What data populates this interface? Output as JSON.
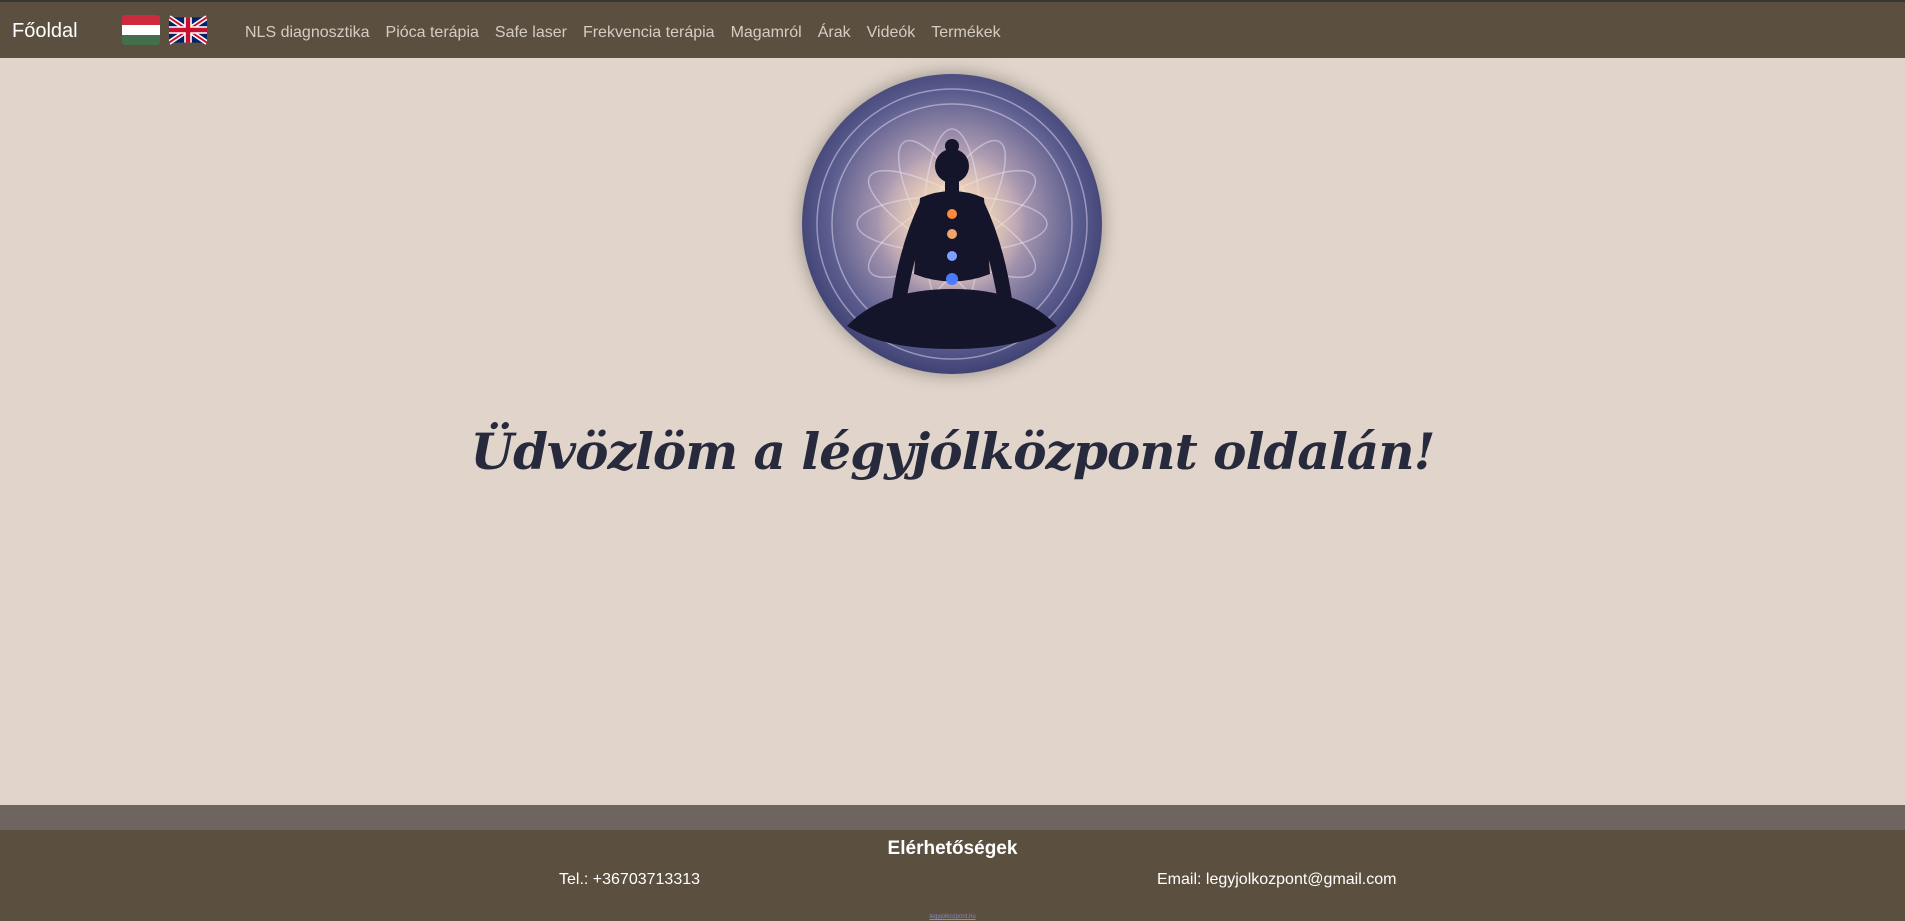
{
  "nav": {
    "brand": "Főoldal",
    "languages": [
      {
        "name": "hungarian-flag",
        "colors": [
          "#cd2a3e",
          "#ffffff",
          "#436f4d"
        ]
      },
      {
        "name": "uk-flag",
        "colors": [
          "#012169",
          "#ffffff",
          "#c8102e"
        ]
      }
    ],
    "links": [
      {
        "label": "NLS diagnosztika"
      },
      {
        "label": "Pióca terápia"
      },
      {
        "label": "Safe laser"
      },
      {
        "label": "Frekvencia terápia"
      },
      {
        "label": "Magamról"
      },
      {
        "label": "Árak"
      },
      {
        "label": "Videók"
      },
      {
        "label": "Termékek"
      }
    ]
  },
  "hero": {
    "image": "meditation-chakra-lotus-image",
    "welcome": "Üdvözlöm a légyjólközpont oldalán!"
  },
  "footer": {
    "title": "Elérhetőségek",
    "tel": "Tel.: +36703713313",
    "email": "Email: legyjolkozpont@gmail.com",
    "tiny_link": "legyjolkozpont.hu"
  },
  "colors": {
    "navbar": "#5b4f40",
    "background": "#e1d5cb",
    "footer": "#5b4f40",
    "footer_band": "#6f6560",
    "welcome_text": "#272a3c"
  }
}
